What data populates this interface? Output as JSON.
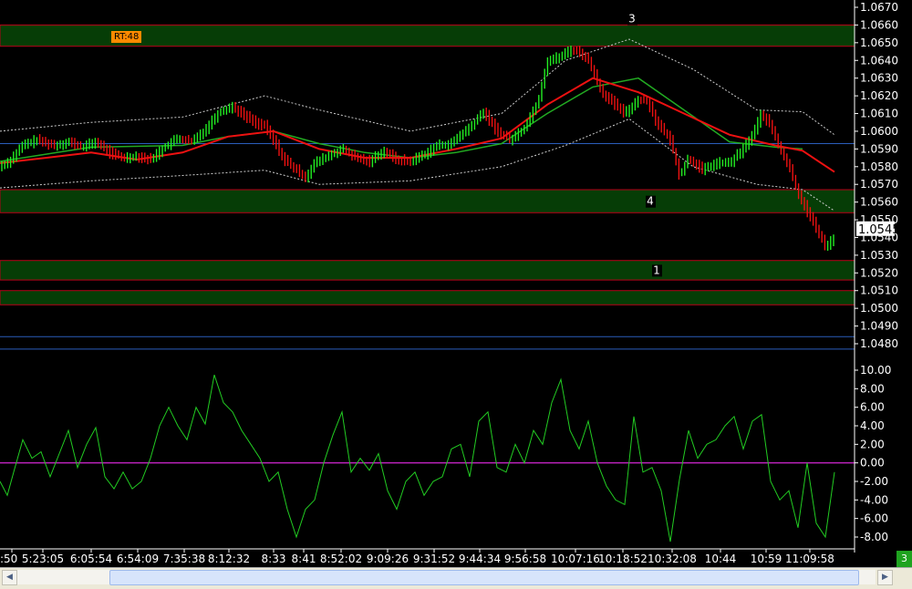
{
  "chart_data": [
    {
      "type": "candlestick",
      "title": "",
      "ylim": [
        1.0465,
        1.0676
      ],
      "y_ticks": [
        "1.0670",
        "1.0660",
        "1.0650",
        "1.0640",
        "1.0630",
        "1.0620",
        "1.0610",
        "1.0600",
        "1.0590",
        "1.0580",
        "1.0570",
        "1.0560",
        "1.0550",
        "1.0540",
        "1.0530",
        "1.0520",
        "1.0510",
        "1.0500",
        "1.0490",
        "1.0480"
      ],
      "y_tick_values": [
        1.067,
        1.066,
        1.065,
        1.064,
        1.063,
        1.062,
        1.061,
        1.06,
        1.059,
        1.058,
        1.057,
        1.056,
        1.055,
        1.054,
        1.053,
        1.052,
        1.051,
        1.05,
        1.049,
        1.048
      ],
      "last_price": "1.0545",
      "rt_badge": "RT:48",
      "up_color": "#22ee22",
      "down_color": "#ee1111",
      "ma_fast_color": "#ee1111",
      "ma_slow_color": "#22aa22",
      "zones": [
        {
          "low": 1.0648,
          "high": 1.066,
          "label": "3"
        },
        {
          "low": 1.0554,
          "high": 1.0567,
          "label": "4"
        },
        {
          "low": 1.0516,
          "high": 1.0527,
          "label": "1"
        },
        {
          "low": 1.0502,
          "high": 1.051,
          "label": ""
        }
      ],
      "horizontal_lines": [
        1.0593,
        1.0484,
        1.0477
      ],
      "price_path": [
        [
          0,
          1.058
        ],
        [
          10,
          1.0583
        ],
        [
          25,
          1.0592
        ],
        [
          40,
          1.0595
        ],
        [
          60,
          1.0592
        ],
        [
          75,
          1.0594
        ],
        [
          90,
          1.0591
        ],
        [
          105,
          1.0594
        ],
        [
          120,
          1.0588
        ],
        [
          135,
          1.0585
        ],
        [
          150,
          1.0586
        ],
        [
          165,
          1.0584
        ],
        [
          180,
          1.0591
        ],
        [
          195,
          1.0596
        ],
        [
          210,
          1.0594
        ],
        [
          225,
          1.0601
        ],
        [
          240,
          1.0611
        ],
        [
          255,
          1.0614
        ],
        [
          265,
          1.061
        ],
        [
          280,
          1.0605
        ],
        [
          290,
          1.0603
        ],
        [
          300,
          1.0595
        ],
        [
          310,
          1.0585
        ],
        [
          320,
          1.058
        ],
        [
          335,
          1.0574
        ],
        [
          345,
          1.0582
        ],
        [
          360,
          1.0586
        ],
        [
          375,
          1.059
        ],
        [
          390,
          1.0585
        ],
        [
          405,
          1.0583
        ],
        [
          420,
          1.0589
        ],
        [
          435,
          1.0584
        ],
        [
          450,
          1.0583
        ],
        [
          465,
          1.0587
        ],
        [
          480,
          1.0592
        ],
        [
          495,
          1.0593
        ],
        [
          505,
          1.0598
        ],
        [
          515,
          1.0602
        ],
        [
          530,
          1.0611
        ],
        [
          545,
          1.06
        ],
        [
          560,
          1.0595
        ],
        [
          575,
          1.0602
        ],
        [
          590,
          1.0617
        ],
        [
          600,
          1.064
        ],
        [
          615,
          1.0642
        ],
        [
          625,
          1.0646
        ],
        [
          635,
          1.0645
        ],
        [
          645,
          1.064
        ],
        [
          660,
          1.0622
        ],
        [
          670,
          1.0617
        ],
        [
          685,
          1.061
        ],
        [
          700,
          1.0618
        ],
        [
          710,
          1.0617
        ],
        [
          720,
          1.0605
        ],
        [
          735,
          1.0595
        ],
        [
          745,
          1.0575
        ],
        [
          755,
          1.0585
        ],
        [
          770,
          1.0578
        ],
        [
          785,
          1.0582
        ],
        [
          800,
          1.0582
        ],
        [
          815,
          1.059
        ],
        [
          825,
          1.0598
        ],
        [
          835,
          1.061
        ],
        [
          845,
          1.0603
        ],
        [
          855,
          1.059
        ],
        [
          865,
          1.058
        ],
        [
          875,
          1.0565
        ],
        [
          885,
          1.0555
        ],
        [
          895,
          1.0545
        ],
        [
          905,
          1.0535
        ],
        [
          915,
          1.054
        ]
      ],
      "ma_fast": [
        [
          0,
          1.0582
        ],
        [
          50,
          1.0585
        ],
        [
          100,
          1.0588
        ],
        [
          150,
          1.0584
        ],
        [
          200,
          1.0588
        ],
        [
          250,
          1.0597
        ],
        [
          300,
          1.06
        ],
        [
          350,
          1.059
        ],
        [
          400,
          1.0585
        ],
        [
          450,
          1.0585
        ],
        [
          500,
          1.059
        ],
        [
          550,
          1.0596
        ],
        [
          600,
          1.0615
        ],
        [
          650,
          1.063
        ],
        [
          700,
          1.0622
        ],
        [
          750,
          1.061
        ],
        [
          800,
          1.0598
        ],
        [
          850,
          1.0592
        ],
        [
          880,
          1.0589
        ],
        [
          915,
          1.0577
        ]
      ],
      "ma_slow": [
        [
          0,
          1.0583
        ],
        [
          100,
          1.0591
        ],
        [
          200,
          1.0592
        ],
        [
          250,
          1.0597
        ],
        [
          300,
          1.06
        ],
        [
          350,
          1.0593
        ],
        [
          400,
          1.0588
        ],
        [
          450,
          1.0585
        ],
        [
          500,
          1.0588
        ],
        [
          550,
          1.0593
        ],
        [
          600,
          1.061
        ],
        [
          650,
          1.0625
        ],
        [
          700,
          1.063
        ],
        [
          750,
          1.0612
        ],
        [
          800,
          1.0594
        ],
        [
          850,
          1.0591
        ],
        [
          880,
          1.059
        ]
      ],
      "band_upper": [
        [
          0,
          1.06
        ],
        [
          100,
          1.0605
        ],
        [
          200,
          1.0608
        ],
        [
          290,
          1.062
        ],
        [
          350,
          1.0612
        ],
        [
          450,
          1.06
        ],
        [
          550,
          1.061
        ],
        [
          620,
          1.064
        ],
        [
          690,
          1.0652
        ],
        [
          760,
          1.0635
        ],
        [
          830,
          1.0612
        ],
        [
          880,
          1.0611
        ],
        [
          915,
          1.0598
        ]
      ],
      "band_lower": [
        [
          0,
          1.0568
        ],
        [
          100,
          1.0572
        ],
        [
          200,
          1.0575
        ],
        [
          290,
          1.0578
        ],
        [
          350,
          1.057
        ],
        [
          450,
          1.0572
        ],
        [
          550,
          1.058
        ],
        [
          620,
          1.0592
        ],
        [
          690,
          1.0607
        ],
        [
          760,
          1.058
        ],
        [
          830,
          1.057
        ],
        [
          880,
          1.0567
        ],
        [
          915,
          1.0555
        ]
      ]
    },
    {
      "type": "line",
      "title": "",
      "ylim": [
        -9.5,
        10.5
      ],
      "y_ticks": [
        "10.00",
        "8.00",
        "6.00",
        "4.00",
        "2.00",
        "0.00",
        "-2.00",
        "-4.00",
        "-6.00",
        "-8.00"
      ],
      "y_tick_values": [
        10,
        8,
        6,
        4,
        2,
        0,
        -2,
        -4,
        -6,
        -8
      ],
      "zero_line_color": "#bb22bb",
      "line_color": "#22cc22",
      "series": [
        {
          "x": [
            0,
            8,
            15,
            25,
            35,
            45,
            55,
            65,
            75,
            85,
            95,
            105,
            115,
            125,
            135,
            145,
            155,
            165,
            175,
            185,
            195,
            205,
            215,
            225,
            235,
            245,
            255,
            265,
            275,
            285,
            295,
            305,
            315,
            325,
            335,
            345,
            355,
            365,
            375,
            385,
            395,
            405,
            415,
            425,
            435,
            445,
            455,
            465,
            475,
            485,
            495,
            505,
            515,
            525,
            535,
            545,
            555,
            565,
            575,
            585,
            595,
            605,
            615,
            625,
            635,
            645,
            655,
            665,
            675,
            685,
            695,
            705,
            715,
            725,
            735,
            745,
            755,
            765,
            775,
            785,
            795,
            805,
            815,
            825,
            835,
            845,
            855,
            865,
            875,
            885,
            895,
            905,
            915
          ],
          "y": [
            -2,
            -3.5,
            -1,
            2.5,
            0.5,
            1.2,
            -1.5,
            1,
            3.5,
            -0.5,
            2,
            3.8,
            -1.5,
            -2.8,
            -1,
            -2.8,
            -2,
            0.5,
            4,
            6,
            4,
            2.5,
            6,
            4.2,
            9.5,
            6.5,
            5.5,
            3.5,
            2,
            0.5,
            -2,
            -1,
            -5,
            -8,
            -5,
            -4,
            0,
            3,
            5.5,
            -1,
            0.5,
            -0.8,
            1,
            -3,
            -5,
            -2,
            -1,
            -3.5,
            -2,
            -1.5,
            1.5,
            2,
            -1.5,
            4.5,
            5.5,
            -0.5,
            -1,
            2,
            0,
            3.5,
            2,
            6.5,
            9,
            3.5,
            1.5,
            4.5,
            0,
            -2.5,
            -4,
            -4.5,
            5,
            -1,
            -0.5,
            -3,
            -8.5,
            -1.8,
            3.5,
            0.5,
            2,
            2.5,
            4,
            5,
            1.5,
            4.5,
            5.2,
            -2,
            -4,
            -3,
            -7,
            0,
            -6.5,
            -8,
            -1
          ]
        }
      ]
    }
  ],
  "x_tick_labels": [
    ":50",
    "5:23:05",
    "6:05:54",
    "6:54:09",
    "7:35:38",
    "8:12:32",
    "8:33",
    "8:41",
    "8:52:02",
    "9:09:26",
    "9:31:52",
    "9:44:34",
    "9:56:58",
    "10:07:16",
    "10:18:52",
    "10:32:08",
    "10:44",
    "10:59",
    "11:09:58"
  ],
  "corner_badge": "3",
  "scrollbar": {
    "left_arrow": "◀",
    "right_arrow": "▶"
  }
}
